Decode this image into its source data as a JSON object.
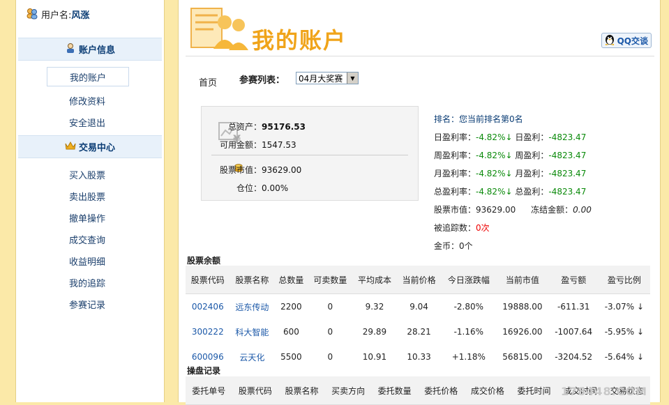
{
  "sidebar": {
    "user_label": "用户名:",
    "user_name": "风涨",
    "section1_title": "账户信息",
    "section1_items": [
      "我的账户",
      "修改资料",
      "安全退出"
    ],
    "section2_title": "交易中心",
    "section2_items": [
      "买入股票",
      "卖出股票",
      "撤单操作",
      "成交查询",
      "收益明细",
      "我的追踪",
      "参赛记录"
    ]
  },
  "header": {
    "title": "我的账户",
    "qq_button": "QQ交谈"
  },
  "toolbar": {
    "home": "首页",
    "contest_label": "参赛列表：",
    "contest_selected": "04月大奖赛"
  },
  "assets": {
    "total_label": "总资产：",
    "total_value": "95176.53",
    "available_label": "可用金额：",
    "available_value": "1547.53",
    "market_label": "股票市值：",
    "market_value": "93629.00",
    "position_label": "仓位：",
    "position_value": "0.00%"
  },
  "ranking": {
    "rank_text": "排名：您当前排名第0名",
    "daily_rate_label": "日盈利率：",
    "daily_rate": "-4.82%↓",
    "daily_profit_label": "日盈利：",
    "daily_profit": "-4823.47",
    "weekly_rate_label": "周盈利率：",
    "weekly_rate": "-4.82%↓",
    "weekly_profit_label": "周盈利：",
    "weekly_profit": "-4823.47",
    "monthly_rate_label": "月盈利率：",
    "monthly_rate": "-4.82%↓",
    "monthly_profit_label": "月盈利：",
    "monthly_profit": "-4823.47",
    "total_rate_label": "总盈利率：",
    "total_rate": "-4.82%↓",
    "total_profit_label": "总盈利：",
    "total_profit": "-4823.47",
    "market_value_label": "股票市值：",
    "market_value": "93629.00",
    "frozen_label": "冻结金额：",
    "frozen_value": "0.00",
    "tracked_label": "被追踪数：",
    "tracked_value": "0次",
    "coins_label": "金币：",
    "coins_value": "0个"
  },
  "holdings": {
    "title": "股票余额",
    "columns": [
      "股票代码",
      "股票名称",
      "总数量",
      "可卖数量",
      "平均成本",
      "当前价格",
      "今日涨跌幅",
      "当前市值",
      "盈亏额",
      "盈亏比例"
    ],
    "rows": [
      {
        "code": "002406",
        "name": "远东传动",
        "total": "2200",
        "sellable": "0",
        "cost": "9.32",
        "price": "9.04",
        "change": "-2.80%",
        "value": "19888.00",
        "pl": "-611.31",
        "pl_pct": "-3.07% ↓"
      },
      {
        "code": "300222",
        "name": "科大智能",
        "total": "600",
        "sellable": "0",
        "cost": "29.89",
        "price": "28.21",
        "change": "-1.16%",
        "value": "16926.00",
        "pl": "-1007.64",
        "pl_pct": "-5.95% ↓"
      },
      {
        "code": "600096",
        "name": "云天化",
        "total": "5500",
        "sellable": "0",
        "cost": "10.91",
        "price": "10.33",
        "change": "+1.18%",
        "value": "56815.00",
        "pl": "-3204.52",
        "pl_pct": "-5.64% ↓"
      }
    ]
  },
  "orders": {
    "title": "操盘记录",
    "columns": [
      "委托单号",
      "股票代码",
      "股票名称",
      "买卖方向",
      "委托数量",
      "委托价格",
      "成交价格",
      "委托时间",
      "成交时间",
      "交易状态"
    ]
  },
  "watermark": "178448.COM",
  "colors": {
    "accent": "#f0a41a",
    "positive": "#e00000",
    "negative": "#0a8a0a",
    "link": "#1b58a8",
    "page_bg": "#fbe9a8"
  }
}
